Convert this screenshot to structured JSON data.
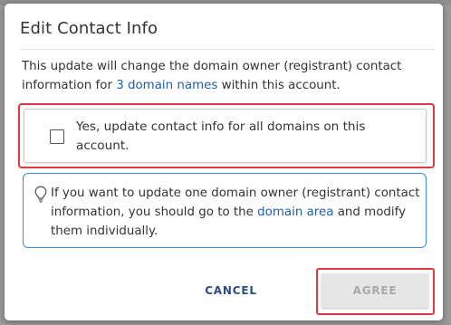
{
  "dialog": {
    "title": "Edit Contact Info",
    "intro": {
      "before": "This update will change the domain owner (registrant) contact information for ",
      "link": "3 domain names",
      "after": " within this account."
    },
    "confirm_checkbox": {
      "label": "Yes, update contact info for all domains on this account.",
      "checked": false
    },
    "info": {
      "icon": "lightbulb-icon",
      "before": "If you want to update one domain owner (registrant) contact information, you should go to the ",
      "link": "domain area",
      "after": " and modify them individually."
    },
    "buttons": {
      "cancel": "CANCEL",
      "agree": "AGREE",
      "agree_disabled": true
    }
  },
  "colors": {
    "link": "#1f5fa8",
    "highlight": "#e0393e",
    "info_border": "#3a8fd6",
    "cancel_text": "#2a4d8a",
    "disabled_bg": "#e6e6e6",
    "disabled_text": "#a9a9a9"
  }
}
